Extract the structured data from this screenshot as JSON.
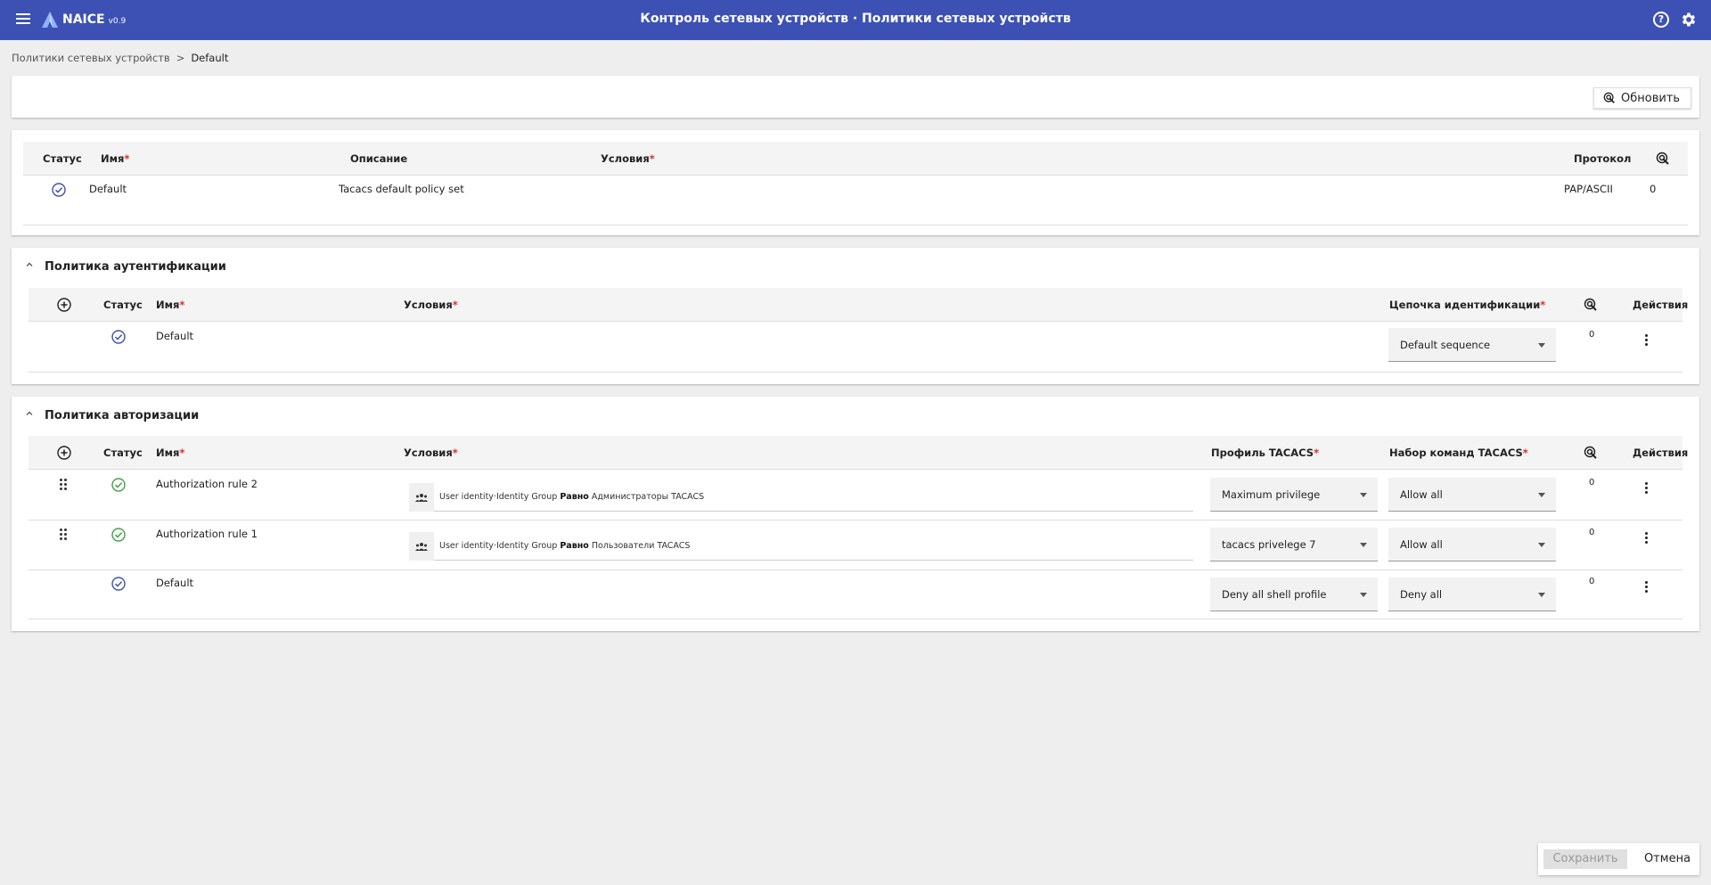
{
  "app": {
    "name": "NAICE",
    "version": "v0.9",
    "title": "Контроль сетевых устройств · Политики сетевых устройств"
  },
  "breadcrumb": {
    "parent": "Политики сетевых устройств",
    "separator": ">",
    "current": "Default"
  },
  "toolbar": {
    "refresh_label": "Обновить"
  },
  "policy_set": {
    "headers": {
      "status": "Статус",
      "name": "Имя",
      "description": "Описание",
      "conditions": "Условия",
      "protocol": "Протокол"
    },
    "row": {
      "name": "Default",
      "description": "Tacacs default policy set",
      "protocol": "PAP/ASCII",
      "hits": "0"
    }
  },
  "auth_policy": {
    "title": "Политика аутентификации",
    "headers": {
      "status": "Статус",
      "name": "Имя",
      "conditions": "Условия",
      "id_chain": "Цепочка идентификации",
      "actions": "Действия"
    },
    "rows": [
      {
        "name": "Default",
        "id_chain": "Default sequence",
        "hits": "0"
      }
    ]
  },
  "authz_policy": {
    "title": "Политика авторизации",
    "headers": {
      "status": "Статус",
      "name": "Имя",
      "conditions": "Условия",
      "tacacs_profile": "Профиль TACACS",
      "command_set": "Набор команд TACACS",
      "actions": "Действия"
    },
    "rows": [
      {
        "name": "Authorization rule 2",
        "cond_prefix": "User identity·Identity Group",
        "cond_op": "Равно",
        "cond_value": "Администраторы TACACS",
        "profile": "Maximum privilege",
        "commands": "Allow all",
        "hits": "0"
      },
      {
        "name": "Authorization rule 1",
        "cond_prefix": "User identity·Identity Group",
        "cond_op": "Равно",
        "cond_value": "Пользователи TACACS",
        "profile": "tacacs privelege 7",
        "commands": "Allow all",
        "hits": "0"
      },
      {
        "name": "Default",
        "profile": "Deny all shell profile",
        "commands": "Deny all",
        "hits": "0"
      }
    ]
  },
  "footer": {
    "save_label": "Сохранить",
    "cancel_label": "Отмена"
  },
  "colors": {
    "primary": "#3d51b4",
    "status_active": "#3d51b4",
    "status_enabled": "#43a047",
    "required": "#d32f2f"
  }
}
